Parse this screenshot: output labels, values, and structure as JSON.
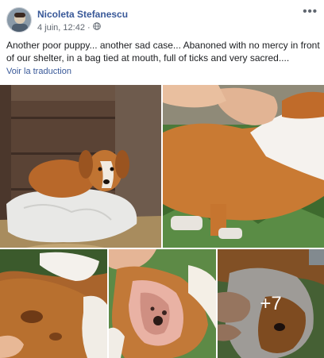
{
  "post": {
    "author": "Nicoleta Stefanescu",
    "timestamp": "4 juin, 12:42",
    "separator": "·",
    "privacy_icon": "globe-icon",
    "menu_icon": "more-options-icon",
    "menu_glyph": "•••",
    "text": "Another poor puppy... another sad case... Abanoned with no mercy in front of our shelter, in a bag tied at mouth, full of ticks and very sacred....",
    "translate_label": "Voir la traduction"
  },
  "photos": {
    "count": 5,
    "more_label": "+7"
  },
  "colors": {
    "link": "#385898",
    "meta": "#606770",
    "text": "#1c1e21"
  }
}
